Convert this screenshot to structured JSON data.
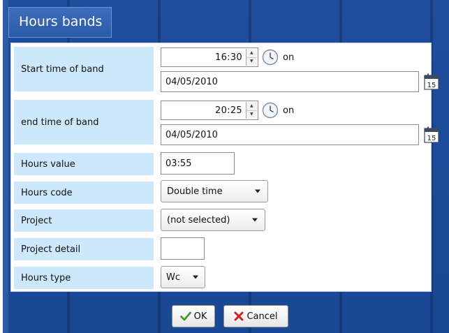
{
  "dialog": {
    "title": "Hours bands"
  },
  "form": {
    "start": {
      "label": "Start time of band",
      "time": "16:30",
      "on_label": "on",
      "date": "04/05/2010"
    },
    "end": {
      "label": "end time of band",
      "time": "20:25",
      "on_label": "on",
      "date": "04/05/2010"
    },
    "hours_value": {
      "label": "Hours value",
      "value": "03:55"
    },
    "hours_code": {
      "label": "Hours code",
      "selected": "Double time"
    },
    "project": {
      "label": "Project",
      "selected": "(not selected)"
    },
    "project_detail": {
      "label": "Project detail",
      "value": ""
    },
    "hours_type": {
      "label": "Hours type",
      "selected": "Wc"
    }
  },
  "calendar_icon_text": "15",
  "buttons": {
    "ok_label": "OK",
    "cancel_label": "Cancel"
  },
  "colors": {
    "dialog_blue": "#1f4f9c",
    "label_bg": "#cce8fa",
    "ok_check": "#4a9a2a",
    "cancel_x": "#d42020"
  },
  "icons": {
    "spinner": "spinner-arrows-icon",
    "clock": "clock-icon",
    "calendar": "calendar-icon",
    "dropdown": "chevron-down-icon",
    "ok": "checkmark-icon",
    "cancel": "x-icon"
  }
}
